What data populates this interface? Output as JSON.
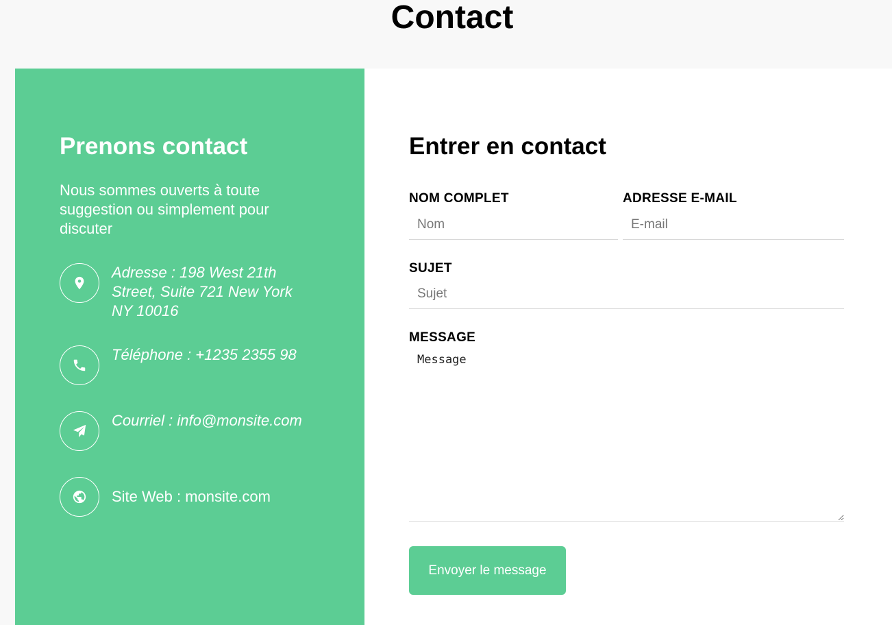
{
  "page": {
    "title": "Contact"
  },
  "info": {
    "heading": "Prenons contact",
    "intro": "Nous sommes ouverts à toute suggestion ou simplement pour discuter",
    "items": [
      {
        "icon": "map-marker-icon",
        "text": "Adresse : 198 West 21th Street, Suite 721 New York NY 10016"
      },
      {
        "icon": "phone-icon",
        "text": "Téléphone : +1235 2355 98"
      },
      {
        "icon": "paper-plane-icon",
        "text": "Courriel : info@monsite.com"
      },
      {
        "icon": "globe-icon",
        "text": "Site Web : monsite.com"
      }
    ]
  },
  "form": {
    "heading": "Entrer en contact",
    "name": {
      "label": "NOM COMPLET",
      "placeholder": "Nom",
      "value": ""
    },
    "email": {
      "label": "ADRESSE E-MAIL",
      "placeholder": "E-mail",
      "value": ""
    },
    "subject": {
      "label": "SUJET",
      "placeholder": "Sujet",
      "value": ""
    },
    "message": {
      "label": "MESSAGE",
      "placeholder": "Message",
      "value": ""
    },
    "submit_label": "Envoyer le message"
  },
  "colors": {
    "accent": "#5ccd94",
    "page_background": "#f8f8f8",
    "card_background": "#ffffff"
  }
}
